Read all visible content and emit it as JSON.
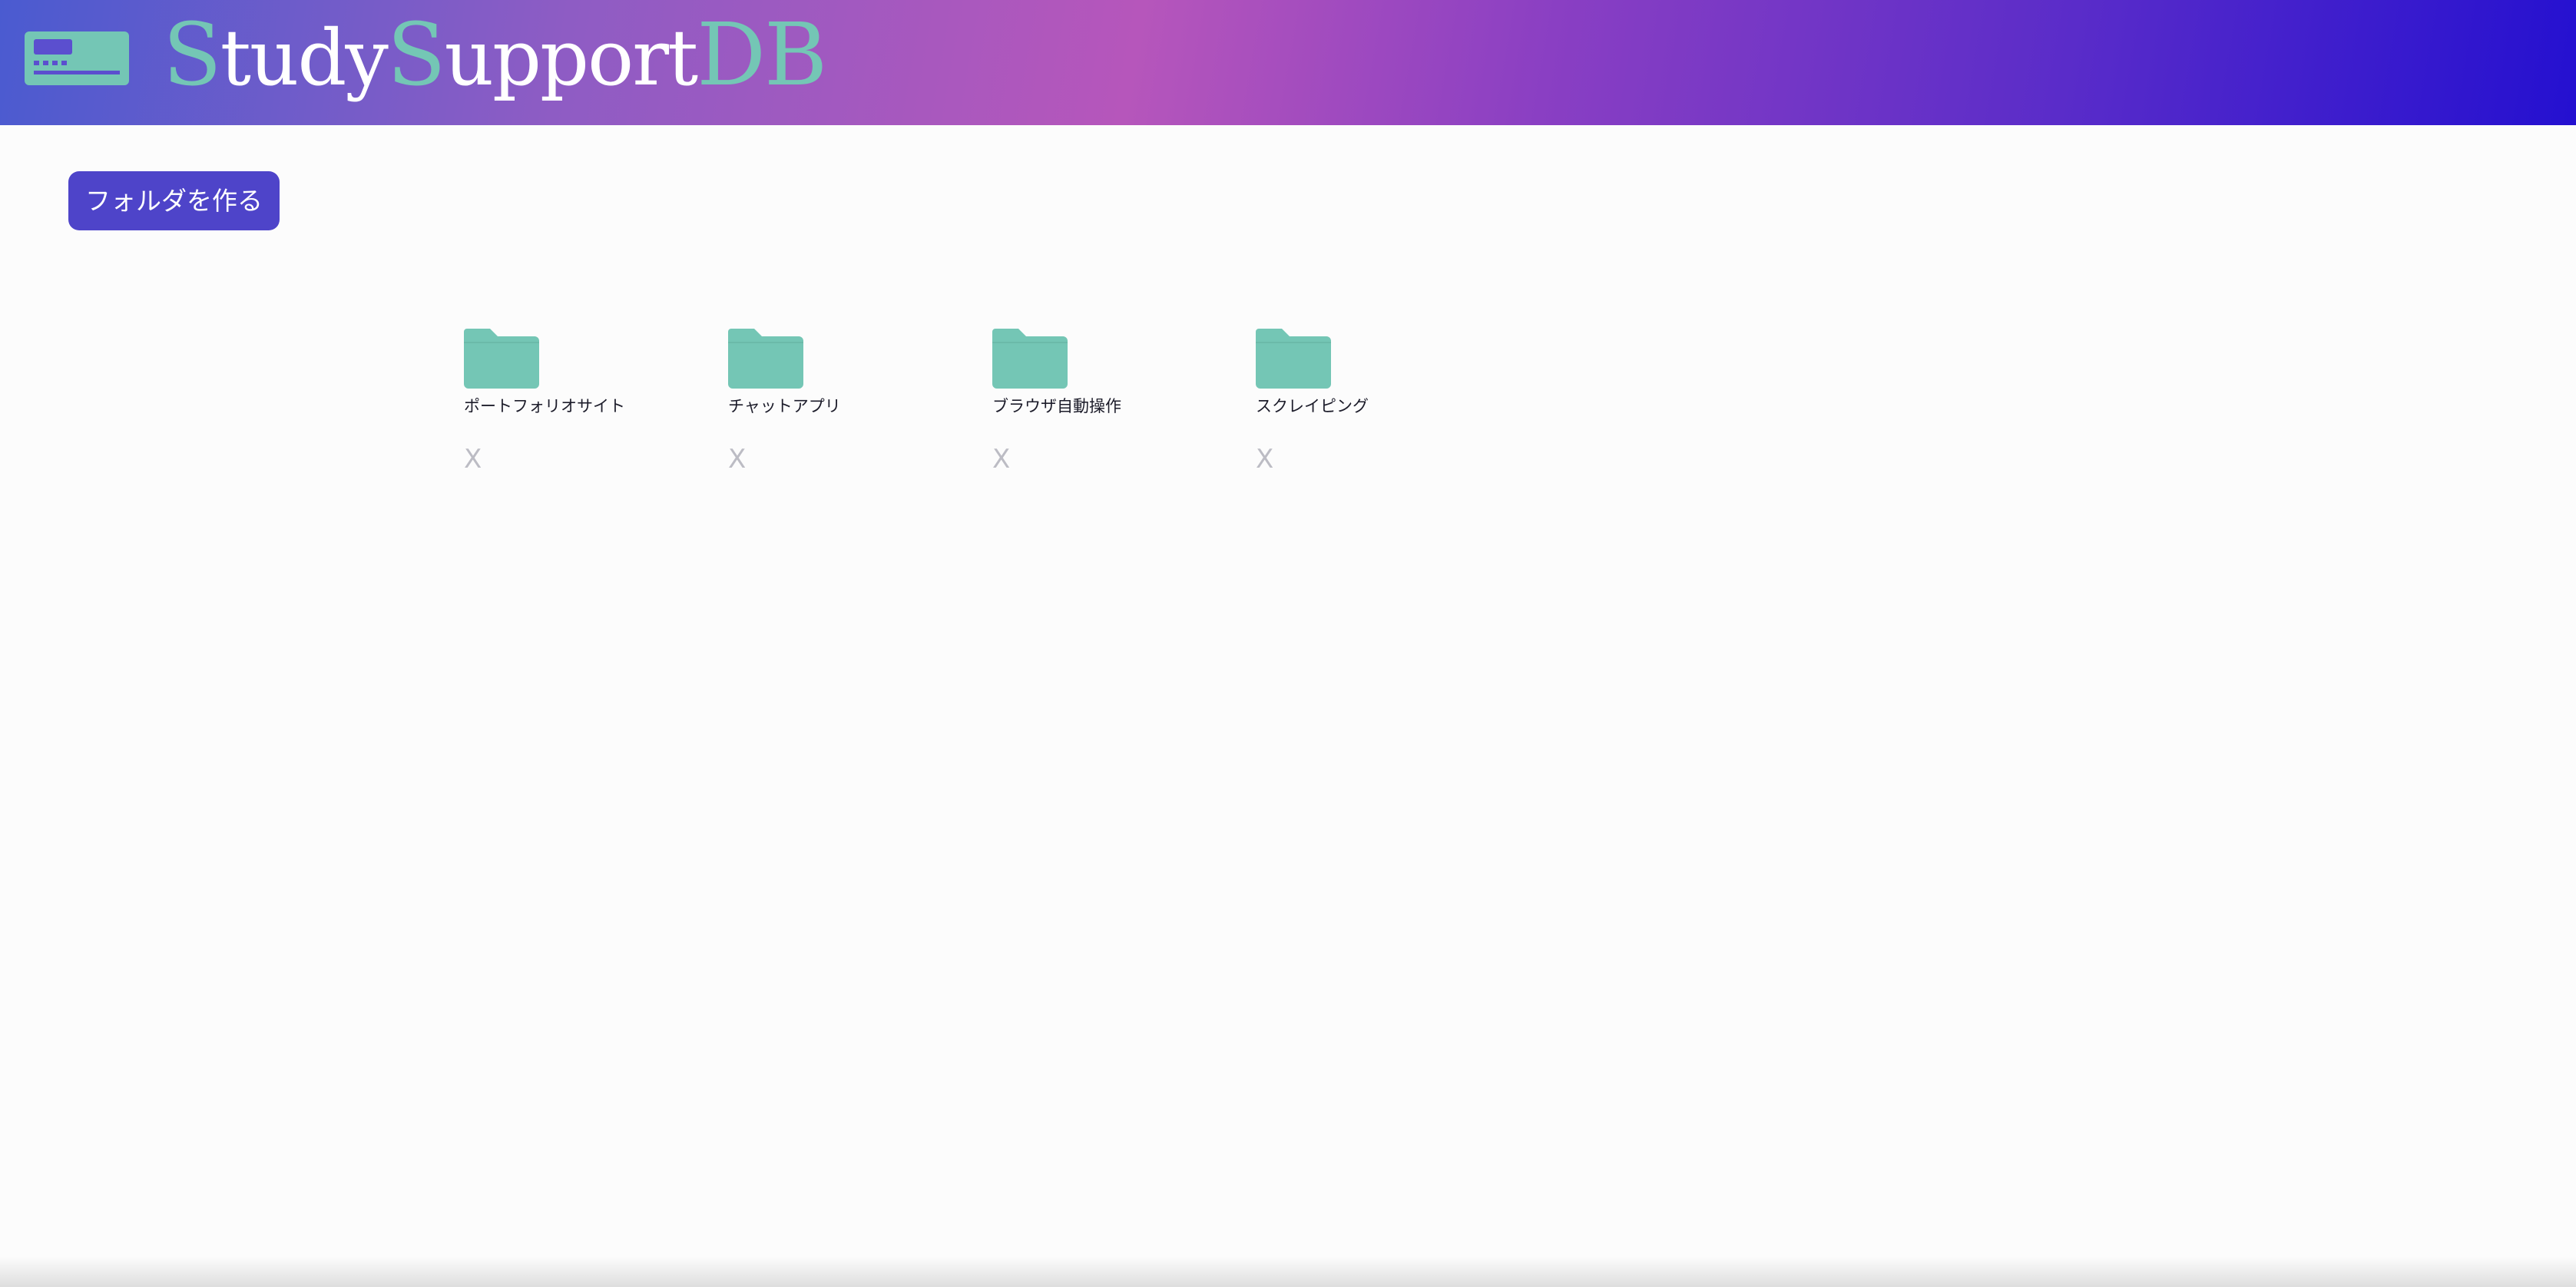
{
  "header": {
    "brand_parts": [
      {
        "text": "S",
        "accent": true
      },
      {
        "text": "tudy",
        "accent": false
      },
      {
        "text": "S",
        "accent": true
      },
      {
        "text": "upport",
        "accent": false
      },
      {
        "text": "DB",
        "accent": true
      }
    ],
    "logo_icon": "id-card-icon",
    "accent_color": "#74c6b5"
  },
  "toolbar": {
    "create_folder_label": "フォルダを作る",
    "button_color": "#4e44c9"
  },
  "folders": [
    {
      "name": "ポートフォリオサイト",
      "delete_label": "X"
    },
    {
      "name": "チャットアプリ",
      "delete_label": "X"
    },
    {
      "name": "ブラウザ自動操作",
      "delete_label": "X"
    },
    {
      "name": "スクレイピング",
      "delete_label": "X"
    }
  ],
  "colors": {
    "folder_icon": "#74c6b5",
    "background": "#fcfcfc"
  }
}
